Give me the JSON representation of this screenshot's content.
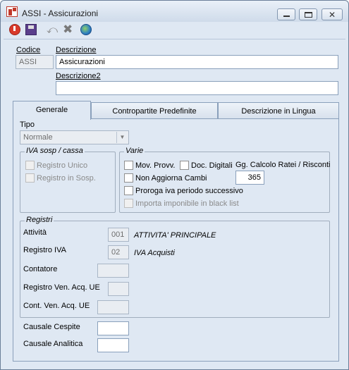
{
  "window": {
    "title": "ASSI - Assicurazioni",
    "icons": {
      "app": "app-logo-icon",
      "minimize": "minimize-icon",
      "maximize": "maximize-icon",
      "close": "close-icon",
      "close_glyph": "✕"
    }
  },
  "toolbar": {
    "items": [
      "power-icon",
      "save-icon",
      "undo-icon",
      "delete-icon",
      "globe-icon"
    ],
    "undo_glyph": "⤺",
    "delete_glyph": "✖"
  },
  "header": {
    "codice_label": "Codice",
    "codice_value": "ASSI",
    "descrizione_label": "Descrizione",
    "descrizione_value": "Assicurazioni",
    "descrizione2_label": "Descrizione2",
    "descrizione2_value": ""
  },
  "tabs": [
    {
      "label": "Generale",
      "active": true
    },
    {
      "label": "Contropartite Predefinite",
      "active": false
    },
    {
      "label": "Descrizione in Lingua",
      "active": false
    }
  ],
  "generale": {
    "tipo_label": "Tipo",
    "tipo_value": "Normale",
    "iva_group": {
      "title": "IVA sosp / cassa",
      "registro_unico": "Registro Unico",
      "registro_sosp": "Registro in Sosp."
    },
    "varie_group": {
      "title": "Varie",
      "mov_provv": "Mov. Provv.",
      "doc_digitali": "Doc. Digitali",
      "gg_calcolo_label": "Gg. Calcolo Ratei / Risconti",
      "gg_calcolo_value": "365",
      "non_aggiorna_cambi": "Non Aggiorna Cambi",
      "proroga_iva": "Proroga iva periodo successivo",
      "importa_imponibile": "Importa imponibile in black list"
    },
    "registri_group": {
      "title": "Registri",
      "attivita_label": "Attività",
      "attivita_code": "001",
      "attivita_desc": "ATTIVITA' PRINCIPALE",
      "registro_iva_label": "Registro IVA",
      "registro_iva_code": "02",
      "registro_iva_desc": "IVA Acquisti",
      "contatore_label": "Contatore",
      "contatore_value": "",
      "registro_ven_label": "Registro Ven. Acq. UE",
      "registro_ven_value": "",
      "cont_ven_label": "Cont. Ven. Acq. UE",
      "cont_ven_value": ""
    },
    "causale_cespite_label": "Causale Cespite",
    "causale_cespite_value": "",
    "causale_analitica_label": "Causale Analitica",
    "causale_analitica_value": ""
  },
  "colors": {
    "window_bg": "#dfe8f3",
    "border": "#8aa0bb",
    "accent_red": "#d93a2b"
  }
}
